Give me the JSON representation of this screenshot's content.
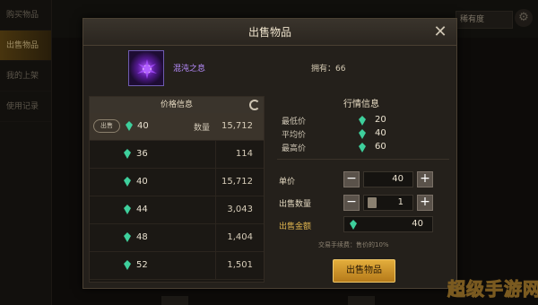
{
  "sidebar": {
    "items": [
      {
        "label": "购买物品",
        "active": false
      },
      {
        "label": "出售物品",
        "active": true
      },
      {
        "label": "我的上架",
        "active": false
      },
      {
        "label": "使用记录",
        "active": false
      }
    ]
  },
  "top": {
    "sort_label": "稀有度",
    "gear_icon": "gear-icon"
  },
  "dialog": {
    "title": "出售物品",
    "item": {
      "name": "混沌之息",
      "owned": "拥有：66"
    },
    "price_table": {
      "header": "价格信息",
      "sell_badge": "出售",
      "qty_label": "数量",
      "rows": [
        {
          "price": "40",
          "qty": "15,712"
        },
        {
          "price": "36",
          "qty": "114"
        },
        {
          "price": "40",
          "qty": "15,712"
        },
        {
          "price": "44",
          "qty": "3,043"
        },
        {
          "price": "48",
          "qty": "1,404"
        },
        {
          "price": "52",
          "qty": "1,501"
        }
      ]
    },
    "market": {
      "header": "行情信息",
      "min_label": "最低价",
      "min_value": "20",
      "avg_label": "平均价",
      "avg_value": "40",
      "max_label": "最高价",
      "max_value": "60"
    },
    "form": {
      "unit_price_label": "单价",
      "unit_price": "40",
      "qty_label": "出售数量",
      "qty": "1",
      "total_label": "出售金额",
      "total": "40",
      "fee_text": "交易手续费：售价的10%",
      "sell_button": "出售物品"
    }
  },
  "watermark": "超级手游网",
  "colors": {
    "accent": "#e0b54f",
    "gem": "#3ecf9c",
    "item_name": "#b88cff"
  }
}
